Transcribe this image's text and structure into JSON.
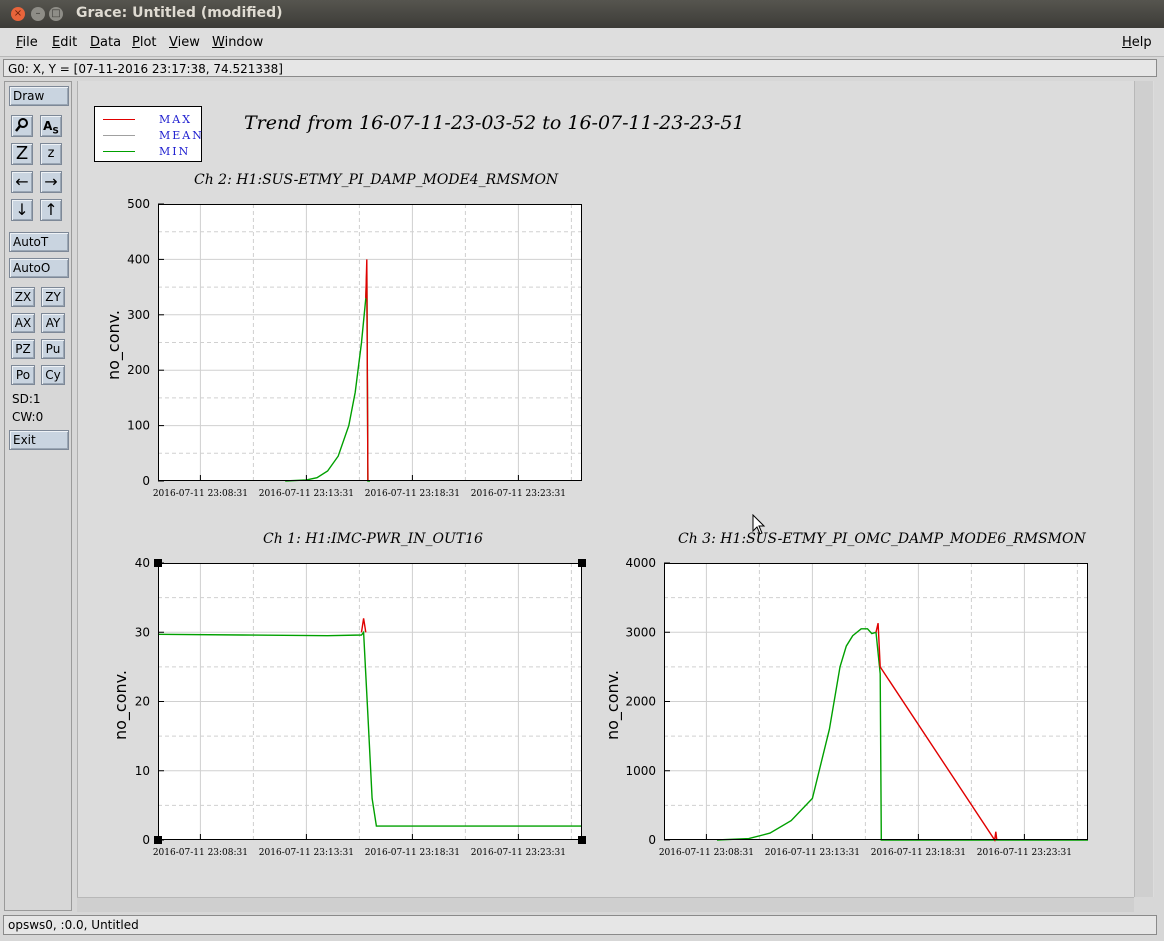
{
  "window": {
    "title": "Grace: Untitled (modified)"
  },
  "menu": {
    "file": "File",
    "edit": "Edit",
    "data": "Data",
    "plot": "Plot",
    "view": "View",
    "window": "Window",
    "help": "Help"
  },
  "coord_readout": "G0: X, Y = [07-11-2016 23:17:38, 74.521338]",
  "toolbar": {
    "draw": "Draw",
    "autot": "AutoT",
    "autoo": "AutoO",
    "zx": "ZX",
    "zy": "ZY",
    "ax": "AX",
    "ay": "AY",
    "pz": "PZ",
    "pu": "Pu",
    "po": "Po",
    "cy": "Cy",
    "sd": "SD:1",
    "cw": "CW:0",
    "exit": "Exit",
    "icons": [
      "zoom-icon",
      "autoscale-text-icon",
      "zoom-in-icon",
      "zoom-out-icon",
      "scroll-left-icon",
      "scroll-right-icon",
      "scroll-down-icon",
      "scroll-up-icon"
    ]
  },
  "status": "opsws0, :0.0, Untitled",
  "legend": {
    "max": "MAX",
    "mean": "MEAN",
    "min": "MIN"
  },
  "trend_title": "Trend from 16-07-11-23-03-52 to 16-07-11-23-23-51",
  "colors": {
    "max": "#e00000",
    "mean": "#a0a0a0",
    "min": "#00a000",
    "legend_text": "#1f1fd0"
  },
  "chart_data": [
    {
      "type": "line",
      "title": "Ch 2: H1:SUS-ETMY_PI_DAMP_MODE4_RMSMON",
      "ylabel": "no_conv.",
      "ylim": [
        0,
        500
      ],
      "yticks": [
        0,
        100,
        200,
        300,
        400,
        500
      ],
      "xlim": [
        0,
        20
      ],
      "xticks": [
        2,
        7,
        12,
        17
      ],
      "xtick_labels": [
        "2016-07-11 23:08:31",
        "2016-07-11 23:13:31",
        "2016-07-11 23:18:31",
        "2016-07-11 23:23:31"
      ],
      "grid": true,
      "series": [
        {
          "name": "MIN",
          "x": [
            6.0,
            7.0,
            7.5,
            8.0,
            8.5,
            9.0,
            9.3,
            9.6,
            9.8,
            9.85,
            9.9,
            10.0
          ],
          "y": [
            0,
            2,
            6,
            18,
            45,
            100,
            160,
            250,
            330,
            380,
            0,
            0
          ]
        },
        {
          "name": "MAX",
          "x": [
            9.8,
            9.85,
            9.9
          ],
          "y": [
            330,
            400,
            0
          ]
        }
      ]
    },
    {
      "type": "line",
      "title": "Ch 1: H1:IMC-PWR_IN_OUT16",
      "ylabel": "no_conv.",
      "ylim": [
        0,
        40
      ],
      "yticks": [
        0,
        10,
        20,
        30,
        40
      ],
      "xlim": [
        0,
        20
      ],
      "xticks": [
        2,
        7,
        12,
        17
      ],
      "xtick_labels": [
        "2016-07-11 23:08:31",
        "2016-07-11 23:13:31",
        "2016-07-11 23:18:31",
        "2016-07-11 23:23:31"
      ],
      "grid": true,
      "series": [
        {
          "name": "MIN",
          "x": [
            0,
            4,
            8,
            9.6,
            9.7,
            9.9,
            10.1,
            10.3,
            10.5,
            20
          ],
          "y": [
            29.7,
            29.6,
            29.5,
            29.6,
            30.0,
            18.0,
            6.0,
            2.0,
            2.0,
            2.0
          ]
        },
        {
          "name": "MAX",
          "x": [
            9.6,
            9.7,
            9.8
          ],
          "y": [
            30.0,
            32.0,
            30.0
          ]
        }
      ]
    },
    {
      "type": "line",
      "title": "Ch 3: H1:SUS-ETMY_PI_OMC_DAMP_MODE6_RMSMON",
      "ylabel": "no_conv.",
      "ylim": [
        0,
        4000
      ],
      "yticks": [
        0,
        1000,
        2000,
        3000,
        4000
      ],
      "xlim": [
        0,
        20
      ],
      "xticks": [
        2,
        7,
        12,
        17
      ],
      "xtick_labels": [
        "2016-07-11 23:08:31",
        "2016-07-11 23:13:31",
        "2016-07-11 23:18:31",
        "2016-07-11 23:23:31"
      ],
      "grid": true,
      "series": [
        {
          "name": "MIN",
          "x": [
            2.5,
            4,
            5,
            6,
            7,
            7.8,
            8.3,
            8.6,
            8.9,
            9.3,
            9.6,
            9.8,
            10.0,
            10.2,
            10.25,
            10.3,
            20
          ],
          "y": [
            0,
            20,
            100,
            280,
            600,
            1600,
            2500,
            2800,
            2950,
            3050,
            3050,
            2980,
            3000,
            2400,
            0,
            0,
            0
          ]
        },
        {
          "name": "MAX",
          "x": [
            10.0,
            10.1,
            10.2,
            15.6,
            15.65,
            15.7
          ],
          "y": [
            3000,
            3130,
            2500,
            0,
            120,
            0
          ]
        }
      ]
    }
  ]
}
